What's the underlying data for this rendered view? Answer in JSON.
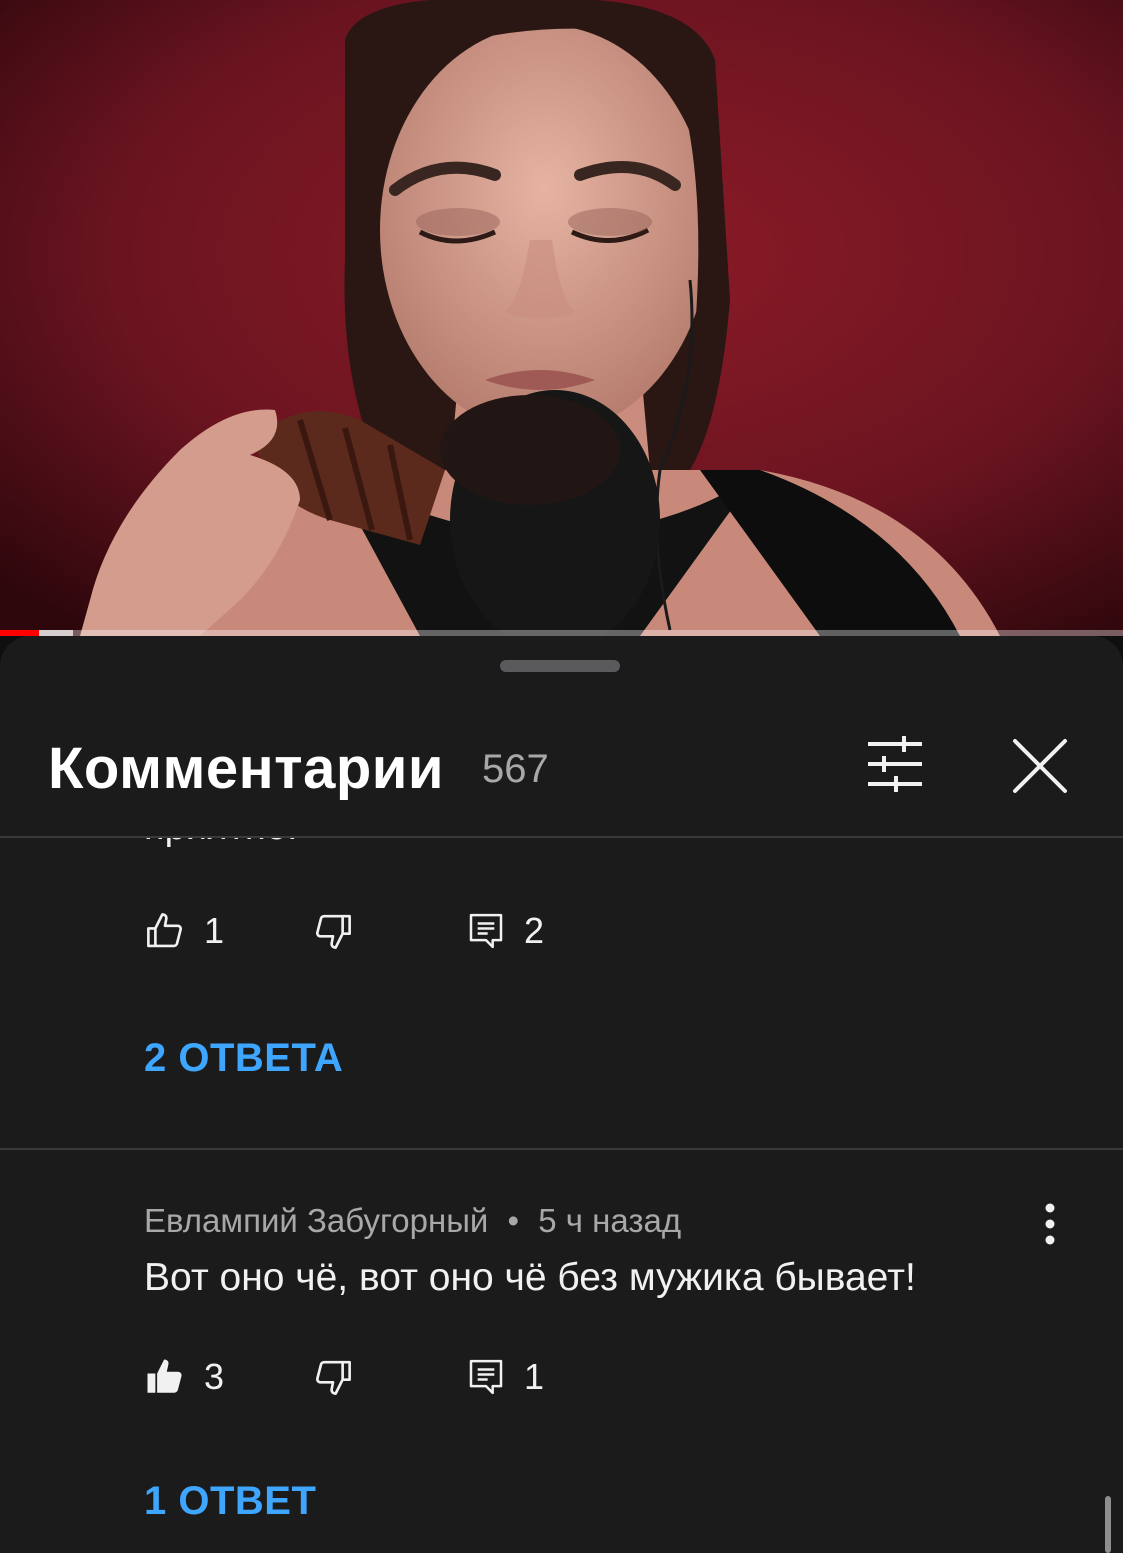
{
  "video": {
    "progress": {
      "played_fraction": 0.035,
      "buffered_fraction": 0.065
    }
  },
  "comments_panel": {
    "title": "Комментарии",
    "count": "567",
    "filter_icon": "sliders-icon",
    "close_icon": "close-icon"
  },
  "comments": [
    {
      "clipped_text": "приятно.",
      "likes": "1",
      "replies_count": "2",
      "replies_link": "2 ОТВЕТА",
      "liked": false
    },
    {
      "author": "Евлампий Забугорный",
      "time": "5 ч назад",
      "separator": "•",
      "text": "Вот оно чё, вот оно чё без мужика бывает!",
      "likes": "3",
      "replies_count": "1",
      "replies_link": "1 ОТВЕТ",
      "liked": true
    }
  ],
  "colors": {
    "sheet_background": "#1b1b1c",
    "accent_link": "#3ea6ff",
    "progress_played": "#ff0000"
  }
}
